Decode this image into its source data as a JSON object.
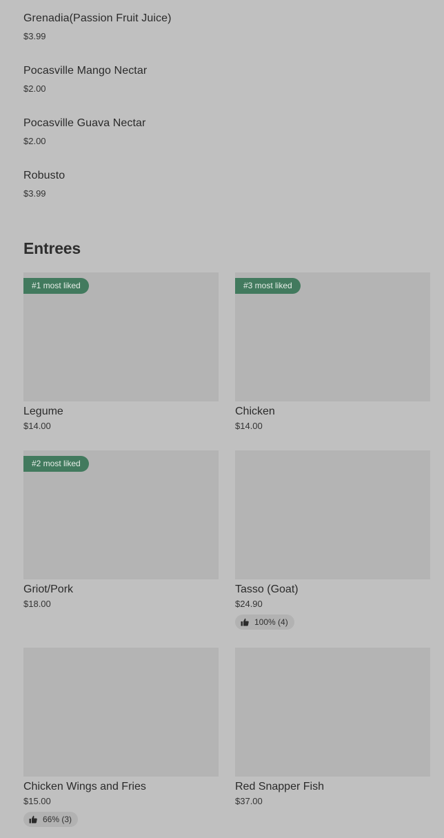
{
  "drinks": [
    {
      "name": "Grenadia(Passion Fruit Juice)",
      "price": "$3.99"
    },
    {
      "name": "Pocasville Mango Nectar",
      "price": "$2.00"
    },
    {
      "name": "Pocasville Guava Nectar",
      "price": "$2.00"
    },
    {
      "name": "Robusto",
      "price": "$3.99"
    }
  ],
  "entrees": {
    "title": "Entrees",
    "items": [
      {
        "name": "Legume",
        "price": "$14.00",
        "badge": "#1 most liked"
      },
      {
        "name": "Chicken",
        "price": "$14.00",
        "badge": "#3 most liked"
      },
      {
        "name": "Griot/Pork",
        "price": "$18.00",
        "badge": "#2 most liked"
      },
      {
        "name": "Tasso (Goat)",
        "price": "$24.90",
        "rating": "100% (4)",
        "rating_icon": "thumbs-up-icon"
      },
      {
        "name": "Chicken Wings and Fries",
        "price": "$15.00",
        "rating": "66% (3)",
        "rating_icon": "thumbs-up-icon"
      },
      {
        "name": "Red Snapper Fish",
        "price": "$37.00"
      }
    ]
  },
  "colors": {
    "background": "#c0c0c0",
    "image_placeholder": "#b4b4b4",
    "badge": "#427a5e"
  }
}
